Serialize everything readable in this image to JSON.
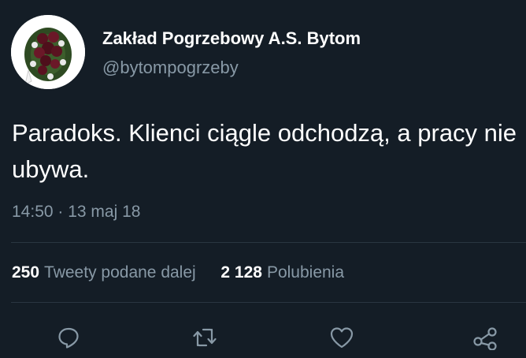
{
  "user": {
    "display_name": "Zakład Pogrzebowy A.S. Bytom",
    "handle": "@bytompogrzeby",
    "avatar": "funeral-wreath-avatar"
  },
  "tweet": {
    "text": "Paradoks. Klienci ciągle odchodzą, a pracy nie ubywa.",
    "timestamp": "14:50 · 13 maj 18"
  },
  "stats": {
    "retweets_count": "250",
    "retweets_label": "Tweety podane dalej",
    "likes_count": "2 128",
    "likes_label": "Polubienia"
  },
  "actions": {
    "icons": [
      "reply-icon",
      "retweet-icon",
      "like-icon",
      "share-icon"
    ]
  },
  "colors": {
    "background": "#141d26",
    "secondary_text": "#8899a6",
    "divider": "#2a3641"
  }
}
